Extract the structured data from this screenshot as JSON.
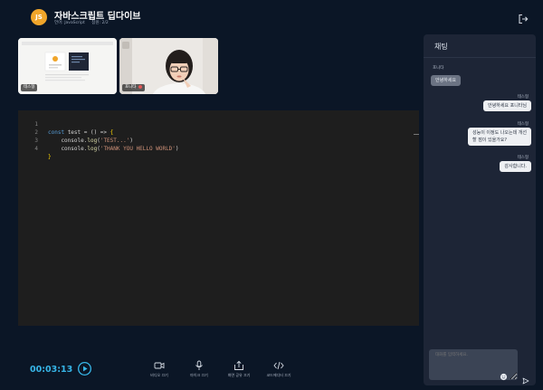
{
  "header": {
    "logo_text": "JS",
    "title": "자바스크립트 딥다이브",
    "language": "언어: JavaScript",
    "participants": "참원: 2/2"
  },
  "video": {
    "tiles": [
      {
        "name": "테스형",
        "mic_off": false
      },
      {
        "name": "포니타",
        "mic_off": true
      }
    ]
  },
  "editor": {
    "lines": [
      {
        "num": "1",
        "text": "const test = () => {"
      },
      {
        "num": "2",
        "text": "    console.log('TEST...')"
      },
      {
        "num": "3",
        "text": "    console.log('THANK YOU HELLO WORLD')"
      },
      {
        "num": "4",
        "text": "}"
      }
    ]
  },
  "chat": {
    "title": "채팅",
    "messages": [
      {
        "sender": "포니타",
        "text": "안녕하세요",
        "direction": "in"
      },
      {
        "sender": "테스형",
        "text": "안녕하세요 포니타님",
        "direction": "out"
      },
      {
        "sender": "테스형",
        "text": "성능이 이정도 나오는데 개선",
        "text2": "할 점이 있을가요?",
        "direction": "out"
      },
      {
        "sender": "테스형",
        "text": "감사합니다.",
        "direction": "out"
      }
    ],
    "input_placeholder": "대화를 입력하세요."
  },
  "bottom": {
    "timer": "00:03:13",
    "controls": [
      {
        "label": "비디오 끄기",
        "icon": "video-icon"
      },
      {
        "label": "마이크 끄기",
        "icon": "mic-icon"
      },
      {
        "label": "화면 공유 끄기",
        "icon": "share-screen-icon"
      },
      {
        "label": "코드에디터 끄기",
        "icon": "code-icon"
      }
    ]
  },
  "colors": {
    "background": "#0b1626",
    "accent": "#37b6e8",
    "logo": "#f0a52a",
    "panel": "#1d2536",
    "editor": "#1e1e1e"
  }
}
